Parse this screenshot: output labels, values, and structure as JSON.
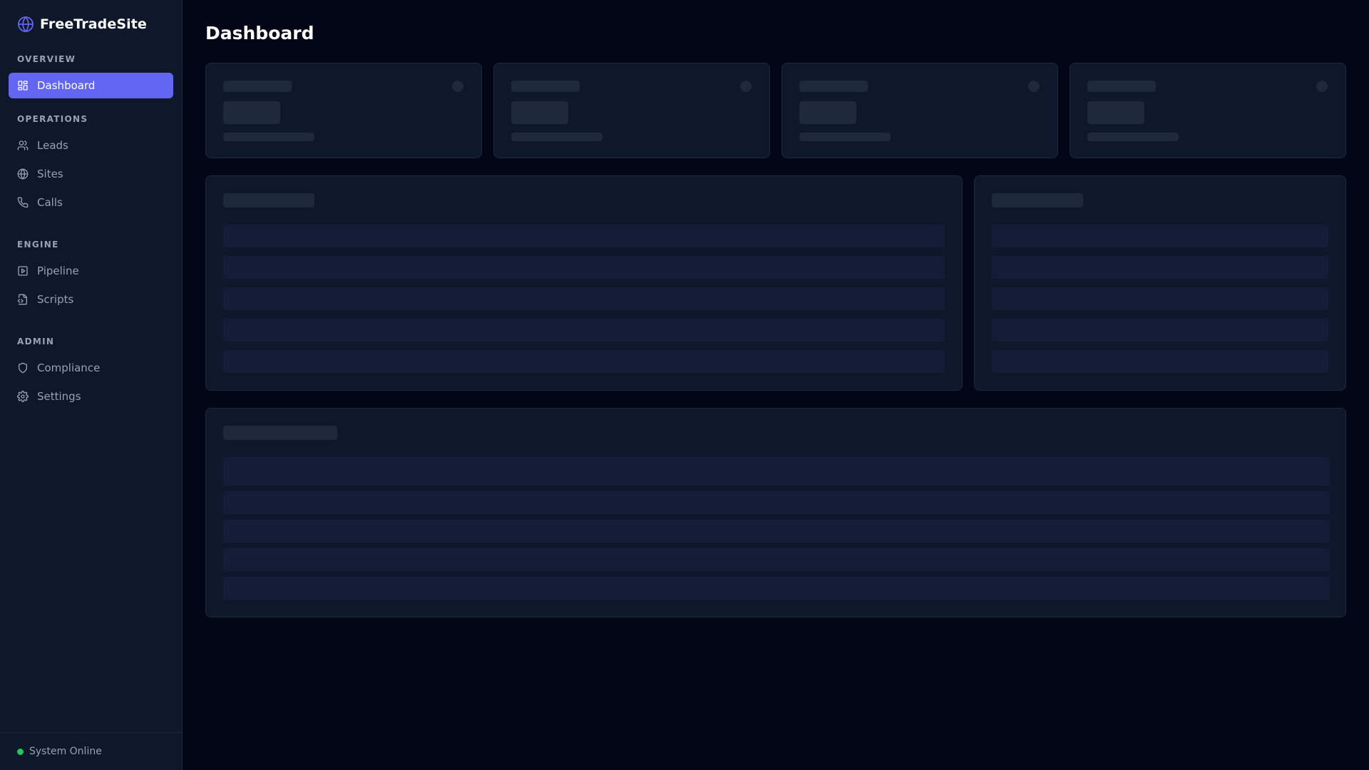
{
  "app": {
    "name": "FreeTradeSite"
  },
  "sidebar": {
    "sections": [
      {
        "label": "OVERVIEW",
        "items": [
          {
            "label": "Dashboard",
            "icon": "dashboard-icon",
            "active": true
          }
        ]
      },
      {
        "label": "OPERATIONS",
        "items": [
          {
            "label": "Leads",
            "icon": "users-icon"
          },
          {
            "label": "Sites",
            "icon": "globe-icon"
          },
          {
            "label": "Calls",
            "icon": "phone-icon"
          }
        ]
      },
      {
        "label": "ENGINE",
        "items": [
          {
            "label": "Pipeline",
            "icon": "play-square-icon"
          },
          {
            "label": "Scripts",
            "icon": "file-code-icon"
          }
        ]
      },
      {
        "label": "ADMIN",
        "items": [
          {
            "label": "Compliance",
            "icon": "shield-icon"
          },
          {
            "label": "Settings",
            "icon": "gear-icon"
          }
        ]
      }
    ],
    "status": {
      "label": "System Online",
      "color": "#22c55e"
    }
  },
  "main": {
    "title": "Dashboard"
  },
  "colors": {
    "accent": "#6366f1",
    "background": "#020617",
    "sidebar": "#0f172a",
    "card": "#0f172a",
    "border": "#1e293b"
  }
}
